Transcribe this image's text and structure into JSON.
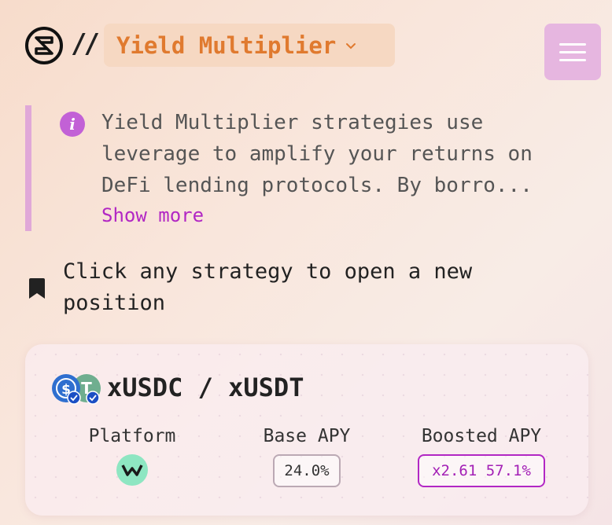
{
  "header": {
    "separator": "//",
    "title": "Yield Multiplier"
  },
  "info": {
    "text": "Yield Multiplier strategies use\nleverage to amplify your returns on\nDeFi lending protocols. By borro...",
    "show_more": "Show more"
  },
  "hint": {
    "text": "Click any strategy to open a new\nposition"
  },
  "strategy_card": {
    "pair": "xUSDC / xUSDT",
    "columns": {
      "platform_label": "Platform",
      "base_apy_label": "Base APY",
      "boosted_apy_label": "Boosted APY"
    },
    "base_apy": "24.0%",
    "boosted_apy": "x2.61 57.1%"
  },
  "colors": {
    "accent": "#e07a2f",
    "purple": "#b227c4",
    "menu_bg": "#e6b6e0"
  }
}
